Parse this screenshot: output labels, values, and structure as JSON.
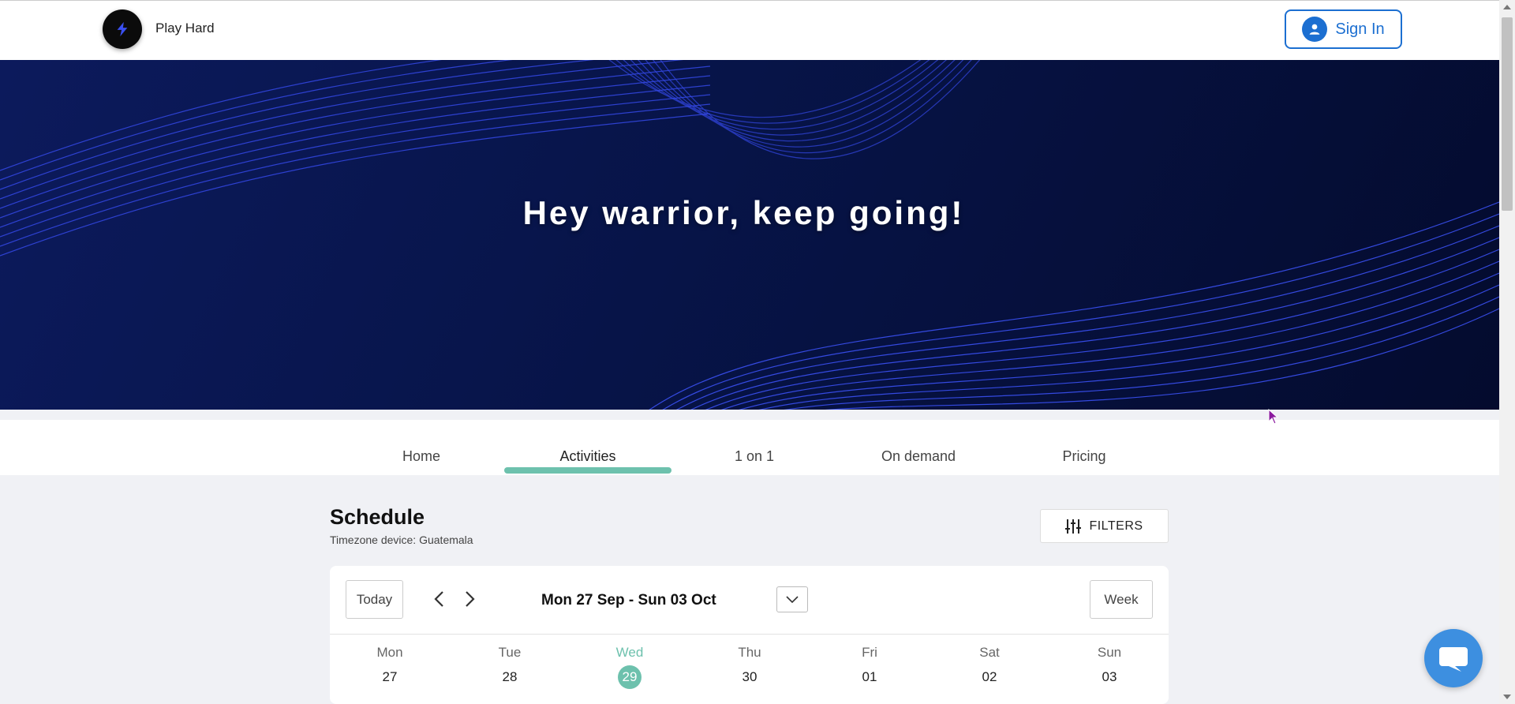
{
  "header": {
    "brand_name": "Play Hard",
    "signin_label": "Sign In"
  },
  "hero": {
    "title": "Hey warrior, keep going!"
  },
  "nav": {
    "items": [
      {
        "label": "Home"
      },
      {
        "label": "Activities"
      },
      {
        "label": "1 on 1"
      },
      {
        "label": "On demand"
      },
      {
        "label": "Pricing"
      }
    ],
    "active": "Activities"
  },
  "schedule": {
    "title": "Schedule",
    "timezone": "Timezone device: Guatemala",
    "filters_label": "FILTERS",
    "today_label": "Today",
    "range_label": "Mon 27 Sep - Sun 03 Oct",
    "view_label": "Week",
    "days": [
      {
        "name": "Mon",
        "num": "27"
      },
      {
        "name": "Tue",
        "num": "28"
      },
      {
        "name": "Wed",
        "num": "29"
      },
      {
        "name": "Thu",
        "num": "30"
      },
      {
        "name": "Fri",
        "num": "01"
      },
      {
        "name": "Sat",
        "num": "02"
      },
      {
        "name": "Sun",
        "num": "03"
      }
    ],
    "today_day": "Wed"
  },
  "colors": {
    "accent": "#6dc1ad",
    "brand_blue": "#1c6fd1",
    "hero_bg": "#071448",
    "chat_blue": "#3d8fe0"
  },
  "icons": {
    "logo": "lightning-bolt-icon",
    "signin": "user-icon",
    "filters": "sliders-icon",
    "prev": "chevron-left-icon",
    "next": "chevron-right-icon",
    "range_dropdown": "chevron-down-icon",
    "chat": "chat-bubble-icon"
  }
}
